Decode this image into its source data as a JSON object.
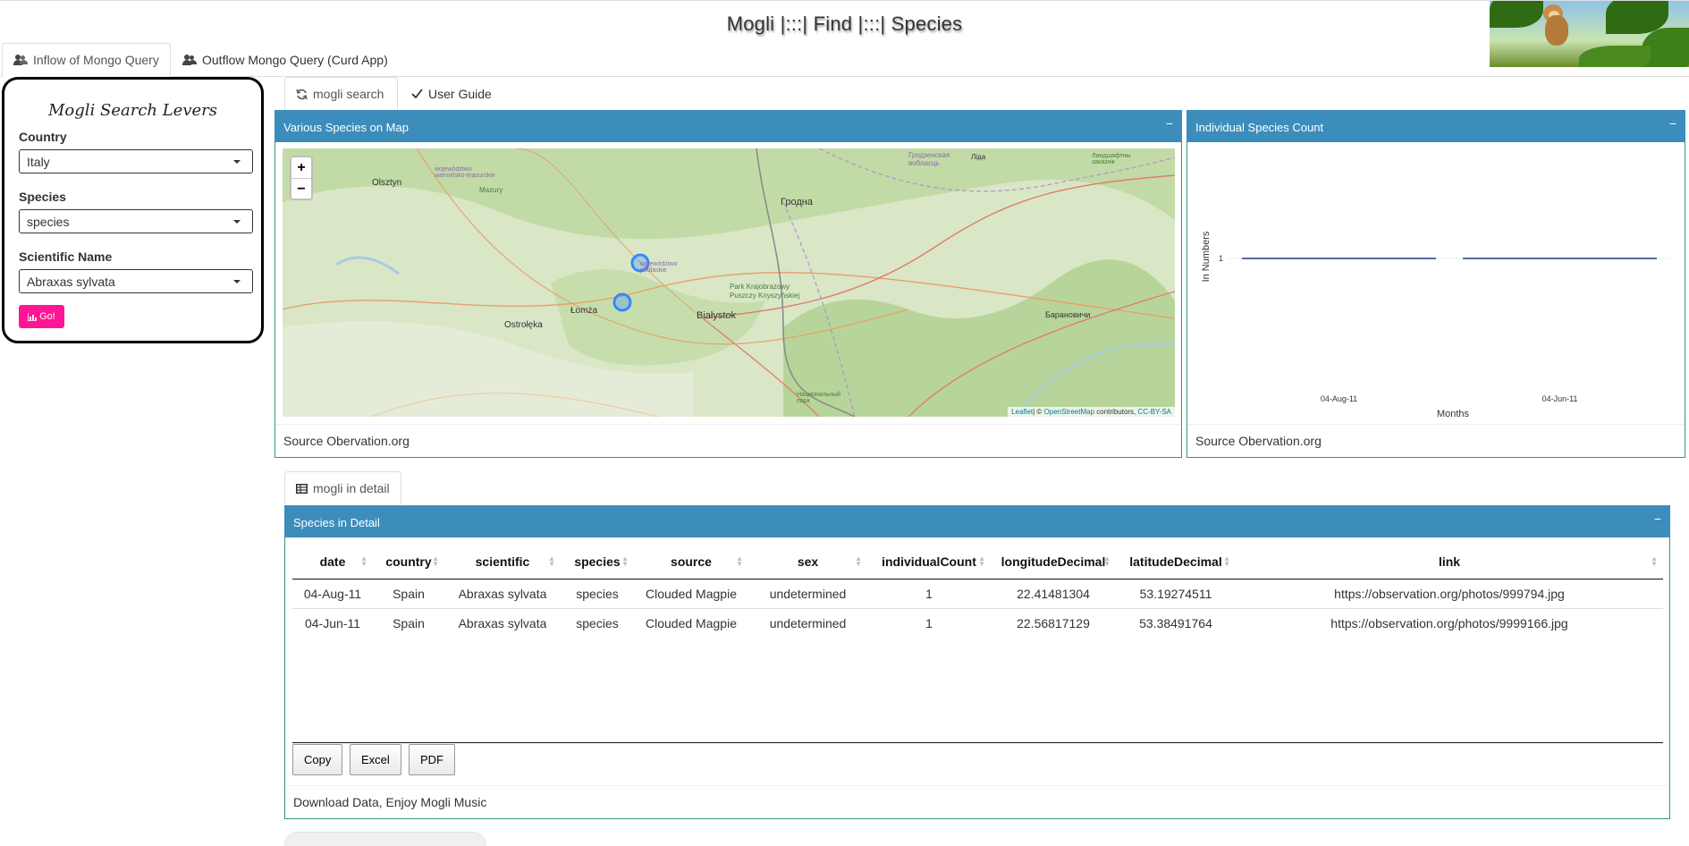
{
  "app": {
    "title": "Mogli |:::| Find |:::| Species"
  },
  "main_tabs": [
    {
      "label": "Inflow of Mongo Query",
      "icon": "users-icon",
      "active": true
    },
    {
      "label": "Outflow Mongo Query (Curd App)",
      "icon": "users-icon",
      "active": false
    }
  ],
  "sidebar": {
    "title": "Mogli Search Levers",
    "country": {
      "label": "Country",
      "value": "Italy"
    },
    "species": {
      "label": "Species",
      "value": "species"
    },
    "scientific": {
      "label": "Scientific Name",
      "value": "Abraxas sylvata"
    },
    "go_label": "Go!",
    "go_color": "#ff1493"
  },
  "sub_tabs": [
    {
      "label": "mogli search",
      "icon": "refresh-icon",
      "active": true
    },
    {
      "label": "User Guide",
      "icon": "check-icon",
      "active": false
    }
  ],
  "map_box": {
    "title": "Various Species on Map",
    "footer": "Source Obervation.org",
    "zoom_in": "+",
    "zoom_out": "−",
    "attribution_leaflet": "Leaflet",
    "attribution_mid": "| © ",
    "attribution_osm": "OpenStreetMap",
    "attribution_contrib": " contributors, ",
    "attribution_license": "CC-BY-SA",
    "places": [
      {
        "name": "Olsztyn"
      },
      {
        "name": "Гродна"
      },
      {
        "name": "Łomża"
      },
      {
        "name": "Ostrołęka"
      },
      {
        "name": "Białystok"
      },
      {
        "name": "Барановичи"
      },
      {
        "name": "Mazury"
      },
      {
        "name": "Park Krajobrazowy"
      },
      {
        "name": "Puszczy Knyszyńskiej"
      },
      {
        "name": "Гродзенская вобласць"
      },
      {
        "name": "województwo warmińsko-mazurskie"
      },
      {
        "name": "województwo podlaskie"
      },
      {
        "name": "Ландшафтны заказнік"
      },
      {
        "name": "Национальный парк"
      },
      {
        "name": "Ліда"
      }
    ]
  },
  "chart_box": {
    "title": "Individual Species Count",
    "footer": "Source Obervation.org"
  },
  "chart_data": {
    "type": "line",
    "xlabel": "Months",
    "ylabel": "In Numbers",
    "categories": [
      "04-Aug-11",
      "04-Jun-11"
    ],
    "series": [
      {
        "values": [
          1,
          1
        ]
      }
    ],
    "y_ticks": [
      1
    ],
    "color": "#1f3c88"
  },
  "detail_tab": {
    "label": "mogli in detail",
    "icon": "table-icon"
  },
  "detail_box": {
    "title": "Species in Detail",
    "footer": "Download Data, Enjoy Mogli Music",
    "columns": [
      "date",
      "country",
      "scientific",
      "species",
      "source",
      "sex",
      "individualCount",
      "longitudeDecimal",
      "latitudeDecimal",
      "link"
    ],
    "rows": [
      [
        "04-Aug-11",
        "Spain",
        "Abraxas sylvata",
        "species",
        "Clouded Magpie",
        "undetermined",
        "1",
        "22.41481304",
        "53.19274511",
        "https://observation.org/photos/999794.jpg"
      ],
      [
        "04-Jun-11",
        "Spain",
        "Abraxas sylvata",
        "species",
        "Clouded Magpie",
        "undetermined",
        "1",
        "22.56817129",
        "53.38491764",
        "https://observation.org/photos/9999166.jpg"
      ]
    ],
    "buttons": [
      "Copy",
      "Excel",
      "PDF"
    ]
  },
  "colors": {
    "header_blue": "#3c8dbc",
    "box_border_green": "#2e9a6a"
  }
}
